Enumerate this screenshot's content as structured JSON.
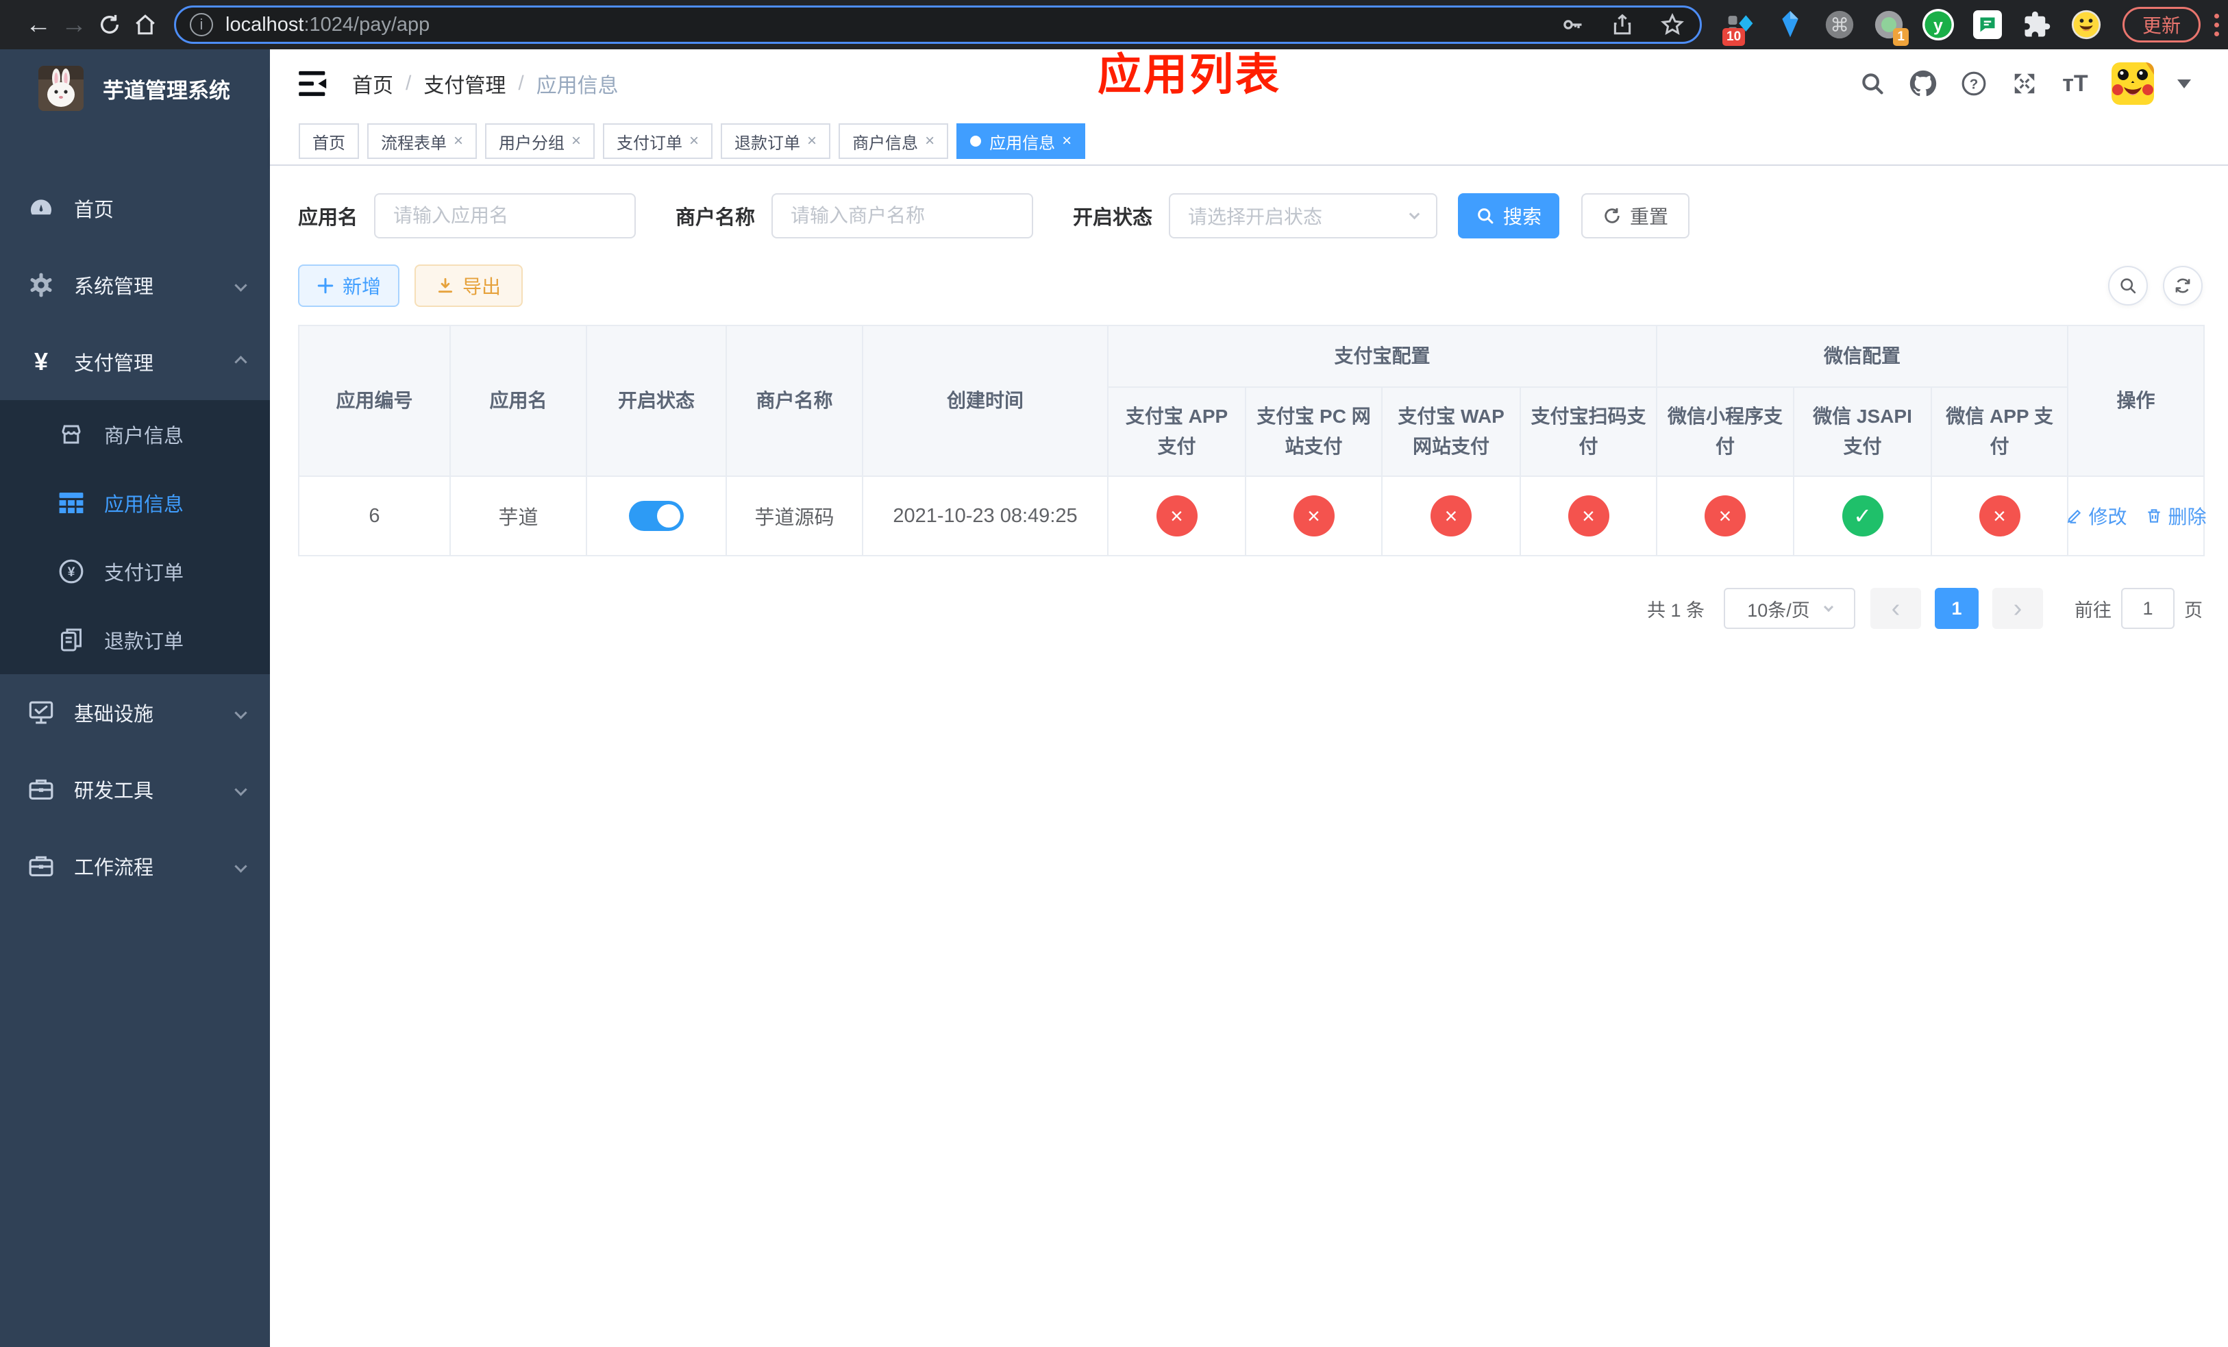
{
  "browser": {
    "url": {
      "host": "localhost",
      "path": ":1024/pay/app"
    },
    "update_button": "更新",
    "extension_badges": {
      "diamond": "10",
      "recorder": "1"
    },
    "extension_letter": "y"
  },
  "sidebar": {
    "title": "芋道管理系统",
    "menu": [
      {
        "label": "首页"
      },
      {
        "label": "系统管理"
      },
      {
        "label": "支付管理"
      },
      {
        "label": "商户信息"
      },
      {
        "label": "应用信息"
      },
      {
        "label": "支付订单"
      },
      {
        "label": "退款订单"
      },
      {
        "label": "基础设施"
      },
      {
        "label": "研发工具"
      },
      {
        "label": "工作流程"
      }
    ]
  },
  "navbar": {
    "breadcrumb": [
      {
        "label": "首页"
      },
      {
        "label": "支付管理"
      },
      {
        "label": "应用信息"
      }
    ],
    "annotation": "应用列表"
  },
  "tags": [
    {
      "label": "首页"
    },
    {
      "label": "流程表单"
    },
    {
      "label": "用户分组"
    },
    {
      "label": "支付订单"
    },
    {
      "label": "退款订单"
    },
    {
      "label": "商户信息"
    },
    {
      "label": "应用信息"
    }
  ],
  "filters": {
    "app_name_label": "应用名",
    "app_name_placeholder": "请输入应用名",
    "merchant_label": "商户名称",
    "merchant_placeholder": "请输入商户名称",
    "status_label": "开启状态",
    "status_placeholder": "请选择开启状态",
    "search_label": "搜索",
    "reset_label": "重置"
  },
  "toolbar": {
    "add_label": "新增",
    "export_label": "导出"
  },
  "table": {
    "group_headers": {
      "alipay": "支付宝配置",
      "wechat": "微信配置"
    },
    "columns": [
      "应用编号",
      "应用名",
      "开启状态",
      "商户名称",
      "创建时间",
      "支付宝 APP 支付",
      "支付宝 PC 网站支付",
      "支付宝 WAP 网站支付",
      "支付宝扫码支付",
      "微信小程序支付",
      "微信 JSAPI 支付",
      "微信 APP 支付",
      "操作"
    ],
    "rows": [
      {
        "id": "6",
        "name": "芋道",
        "enabled": true,
        "merchant": "芋道源码",
        "created_at": "2021-10-23 08:49:25",
        "channel_status": [
          false,
          false,
          false,
          false,
          false,
          true,
          false
        ],
        "actions": {
          "edit": "修改",
          "delete": "删除"
        }
      }
    ]
  },
  "pagination": {
    "total_text": "共 1 条",
    "page_size": "10条/页",
    "current_page": "1",
    "goto_label": "前往",
    "goto_value": "1",
    "page_unit": "页"
  },
  "colors": {
    "primary": "#409EFF",
    "sidebar_bg": "#304156",
    "submenu_bg": "#1f2d3d",
    "success_circle": "#1fc06a",
    "danger_circle": "#f4534e",
    "annotation_red": "#ff1f00",
    "export_orange": "#e6a23c",
    "update_red": "#e9756e"
  }
}
